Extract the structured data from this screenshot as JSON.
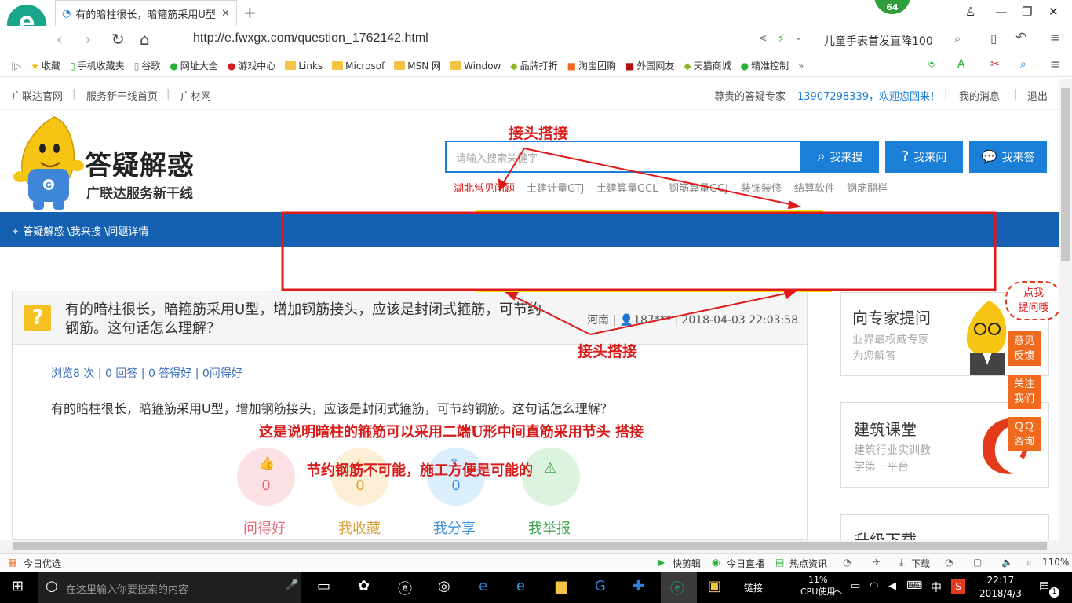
{
  "browser": {
    "tab_title": "有的暗柱很长，暗箍筋采用U型，",
    "url": "http://e.fwxgx.com/question_1762142.html",
    "badge": "64",
    "search_hint": "儿童手表首发直降100",
    "bookmarks": [
      "收藏",
      "手机收藏夹",
      "谷歌",
      "网址大全",
      "游戏中心",
      "Links",
      "Microsof",
      "MSN 网",
      "Window",
      "品牌打折",
      "淘宝团购",
      "外国网友",
      "天猫商城",
      "精准控制",
      "»"
    ]
  },
  "topnav": {
    "links": [
      "广联达官网",
      "服务新干线首页",
      "广材网"
    ],
    "expert": "尊贵的答疑专家",
    "welcome": "13907298339，欢迎您回来！",
    "messages": "我的消息",
    "logout": "退出"
  },
  "brand": {
    "title": "答疑解惑",
    "subtitle": "广联达服务新干线",
    "mascot_letter": "G"
  },
  "search": {
    "placeholder": "请输入搜索关键字",
    "btn_search": "我来搜",
    "btn_ask": "我来问",
    "btn_answer": "我来答",
    "hot": [
      "湖北常见问题",
      "土建计量GTJ",
      "土建算量GCL",
      "钢筋算量GGJ",
      "装饰装修",
      "结算软件",
      "钢筋翻样"
    ]
  },
  "breadcrumb": "答疑解惑 \\我来搜 \\问题详情",
  "question": {
    "title": "有的暗柱很长，暗箍筋采用U型，增加钢筋接头，应该是封闭式箍筋，可节约钢筋。这句话怎么理解？",
    "region": "河南",
    "user": "187***",
    "date": "2018-04-03 22:03:58",
    "stats": "浏览8 次 | 0 回答 | 0 答得好 | 0问得好",
    "body": "有的暗柱很长，暗箍筋采用U型，增加钢筋接头，应该是封闭式箍筋，可节约钢筋。这句话怎么理解？",
    "actions": [
      {
        "count": "0",
        "label": "问得好"
      },
      {
        "count": "0",
        "label": "我收藏"
      },
      {
        "count": "0",
        "label": "我分享"
      },
      {
        "count": "",
        "label": "我举报"
      }
    ]
  },
  "annotations": {
    "top": "接头搭接",
    "bottom": "接头搭接",
    "line1": "这是说明暗柱的箍筋可以采用二端U形中间直筋采用节头 搭接",
    "line2": "节约钢筋不可能，施工方便是可能的"
  },
  "sidebar": [
    {
      "title": "向专家提问",
      "desc1": "业界最权威专家",
      "desc2": "为您解答"
    },
    {
      "title": "建筑课堂",
      "desc1": "建筑行业实训教",
      "desc2": "学第一平台"
    },
    {
      "title": "升级下载"
    }
  ],
  "floats": {
    "bubble1": "点我",
    "bubble2": "提问哦",
    "feedback1": "意见",
    "feedback2": "反馈",
    "follow1": "关注",
    "follow2": "我们",
    "qq1": "ＱＱ",
    "qq2": "咨询"
  },
  "statusbar": {
    "left": "今日优选",
    "kuaijian": "快剪辑",
    "live": "今日直播",
    "news": "热点资讯",
    "download": "下载",
    "zoom": "110%"
  },
  "taskbar": {
    "search_placeholder": "在这里输入你要搜索的内容",
    "links": "链接",
    "cpu_pct": "11%",
    "cpu_label": "CPU使用",
    "ime": "中",
    "time": "22:17",
    "date": "2018/4/3",
    "notif": "1"
  },
  "colors": {
    "site_blue": "#1560b0",
    "button_blue": "#1b7fd8",
    "annotation_red": "#d81b1b",
    "highlight_yellow": "#f5e600"
  }
}
